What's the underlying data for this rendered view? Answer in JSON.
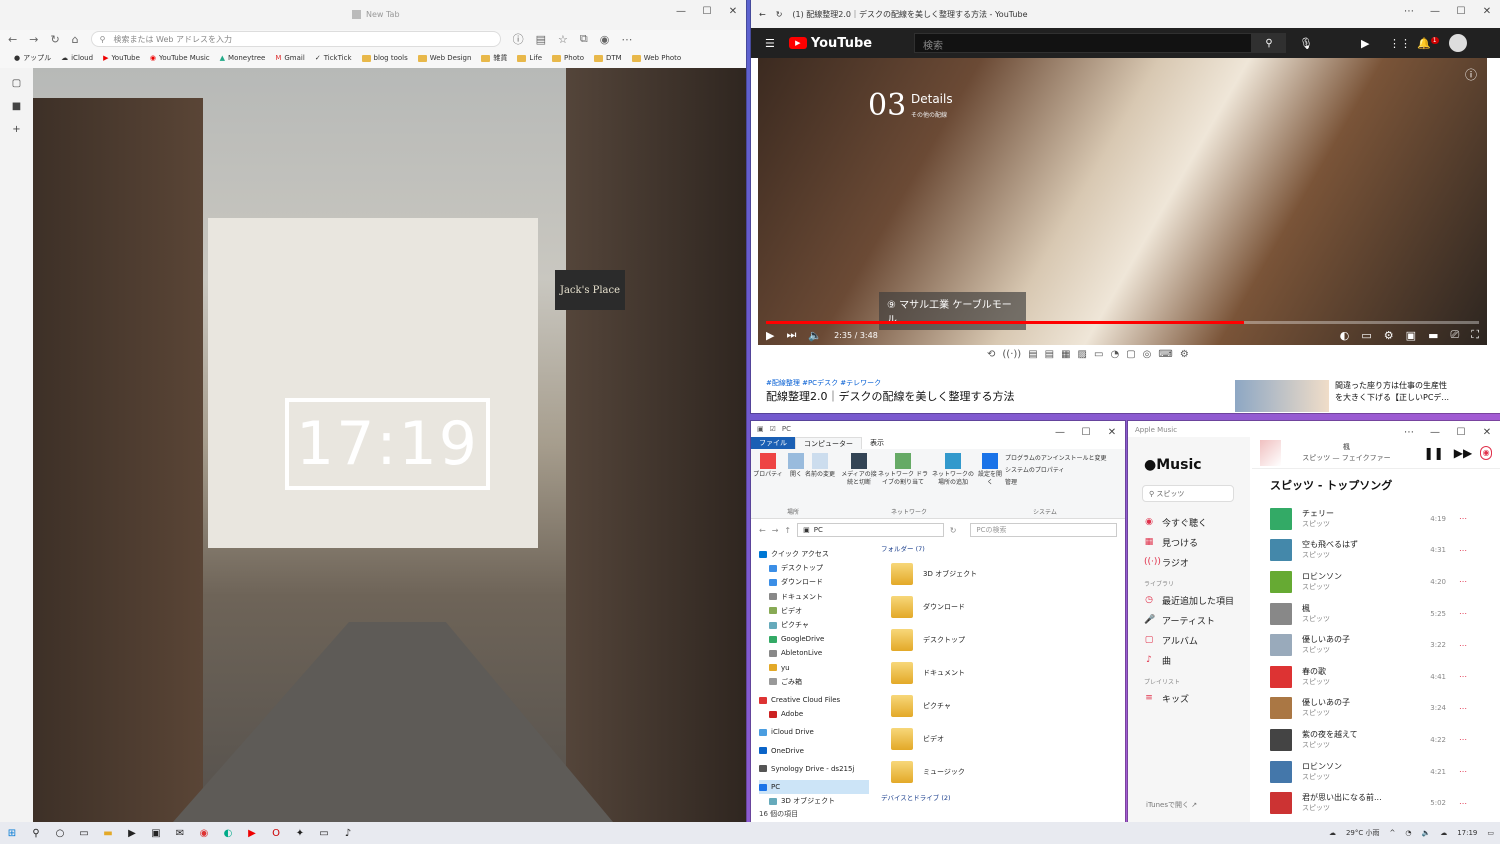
{
  "edge": {
    "tab_title": "New Tab",
    "address_placeholder": "検索または Web アドレスを入力",
    "bookmarks": [
      "アップル",
      "iCloud",
      "YouTube",
      "YouTube Music",
      "Moneytree",
      "Gmail",
      "TickTick",
      "blog tools",
      "Web Design",
      "雑貨",
      "Life",
      "Photo",
      "DTM",
      "Web Photo"
    ],
    "clock": "17:19",
    "sign": "Jack's Place"
  },
  "youtube": {
    "window_title": "(1) 配線整理2.0｜デスクの配線を美しく整理する方法 - YouTube",
    "logo": "YouTube",
    "search_placeholder": "検索",
    "notif_count": "1",
    "video_num": "03",
    "video_heading": "Details",
    "video_sub": "その他の配線",
    "caption": "⑨ マサル工業 ケーブルモール",
    "time": "2:35 / 3:48",
    "progress": 0.67,
    "tags": "#配線整理 #PCデスク #テレワーク",
    "title": "配線整理2.0｜デスクの配線を美しく整理する方法",
    "rec_line1": "間違った座り方は仕事の生産性",
    "rec_line2": "を大きく下げる【正しいPCデ..."
  },
  "explorer": {
    "title": "PC",
    "tabs": [
      "ファイル",
      "コンピューター",
      "表示"
    ],
    "ribbon": [
      "プロパティ",
      "開く",
      "名前の変更",
      "メディアの接続と切断",
      "ネットワーク ドライブの割り当て",
      "ネットワークの場所の追加",
      "設定を開く"
    ],
    "ribbon_right": [
      "プログラムのアンインストールと変更",
      "システムのプロパティ",
      "管理"
    ],
    "groups": [
      "場所",
      "ネットワーク",
      "システム"
    ],
    "path": "PC",
    "search_placeholder": "PCの検索",
    "tree": [
      "クイック アクセス",
      "デスクトップ",
      "ダウンロード",
      "ドキュメント",
      "ビデオ",
      "ピクチャ",
      "GoogleDrive",
      "AbletonLive",
      "yu",
      "ごみ箱",
      "Creative Cloud Files",
      "Adobe",
      "iCloud Drive",
      "OneDrive",
      "Synology Drive - ds215j",
      "PC",
      "3D オブジェクト"
    ],
    "folders_header": "フォルダー (7)",
    "folders": [
      "3D オブジェクト",
      "ダウンロード",
      "デスクトップ",
      "ドキュメント",
      "ピクチャ",
      "ビデオ",
      "ミュージック"
    ],
    "devices_header": "デバイスとドライブ (2)",
    "status": "16 個の項目"
  },
  "music": {
    "window_title": "Apple Music",
    "logo": "Music",
    "search": "スピッツ",
    "nav": [
      "今すぐ聴く",
      "見つける",
      "ラジオ"
    ],
    "library_label": "ライブラリ",
    "library": [
      "最近追加した項目",
      "アーティスト",
      "アルバム",
      "曲"
    ],
    "playlist_label": "プレイリスト",
    "playlists": [
      "キッズ"
    ],
    "open_itunes": "iTunesで開く ↗",
    "now_playing_title": "楓",
    "now_playing_artist": "スピッツ — フェイクファー",
    "heading": "スピッツ - トップソング",
    "songs": [
      {
        "name": "チェリー",
        "artist": "スピッツ",
        "dur": "4:19"
      },
      {
        "name": "空も飛べるはず",
        "artist": "スピッツ",
        "dur": "4:31"
      },
      {
        "name": "ロビンソン",
        "artist": "スピッツ",
        "dur": "4:20"
      },
      {
        "name": "楓",
        "artist": "スピッツ",
        "dur": "5:25"
      },
      {
        "name": "優しいあの子",
        "artist": "スピッツ",
        "dur": "3:22"
      },
      {
        "name": "春の歌",
        "artist": "スピッツ",
        "dur": "4:41"
      },
      {
        "name": "優しいあの子",
        "artist": "スピッツ",
        "dur": "3:24"
      },
      {
        "name": "紫の夜を越えて",
        "artist": "スピッツ",
        "dur": "4:22"
      },
      {
        "name": "ロビンソン",
        "artist": "スピッツ",
        "dur": "4:21"
      },
      {
        "name": "君が思い出になる前...",
        "artist": "スピッツ",
        "dur": "5:02"
      }
    ]
  },
  "taskbar": {
    "weather": "29°C 小雨",
    "time": "17:19"
  }
}
